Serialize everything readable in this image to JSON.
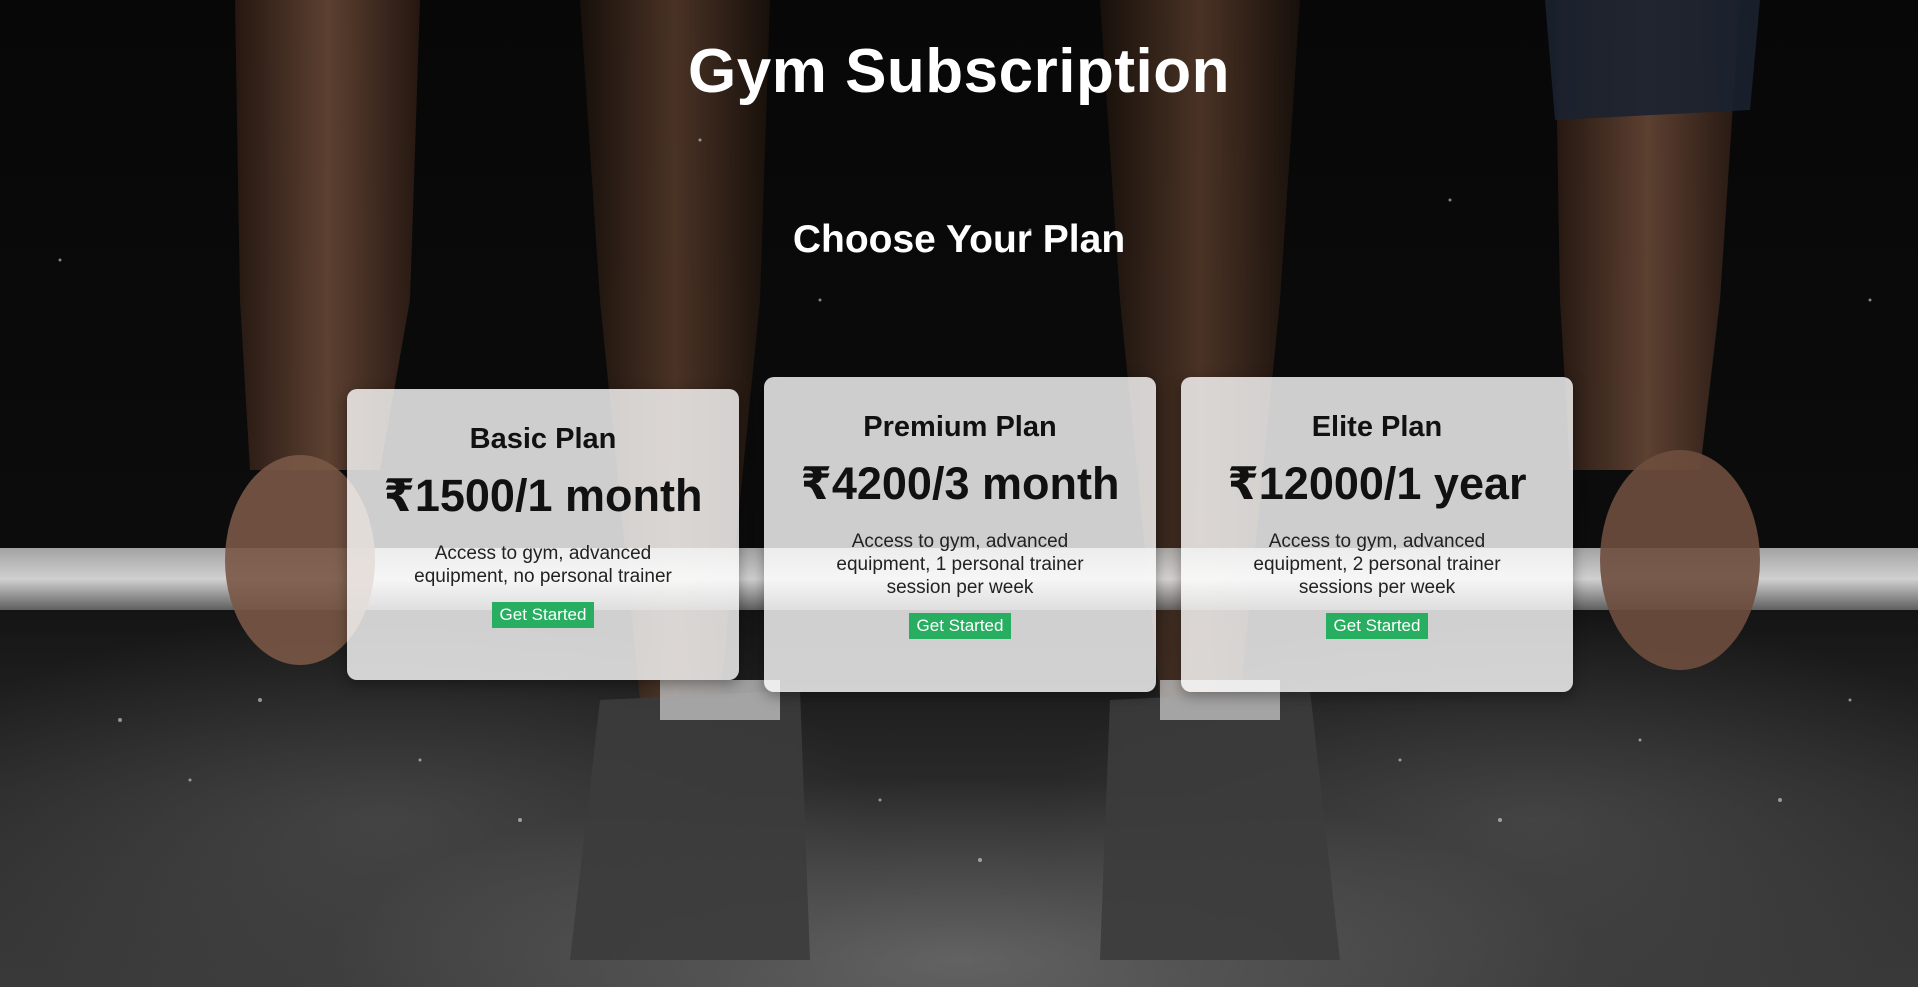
{
  "page": {
    "title": "Gym Subscription",
    "section_title": "Choose Your Plan"
  },
  "plans": [
    {
      "name": "Basic Plan",
      "price": "₹1500/1 month",
      "description": "Access to gym, advanced equipment, no personal trainer",
      "button_label": "Get Started"
    },
    {
      "name": "Premium Plan",
      "price": "₹4200/3 month",
      "description": "Access to gym, advanced equipment, 1 personal trainer session per week",
      "button_label": "Get Started"
    },
    {
      "name": "Elite Plan",
      "price": "₹12000/1 year",
      "description": "Access to gym, advanced equipment, 2 personal trainer sessions per week",
      "button_label": "Get Started"
    }
  ],
  "colors": {
    "button_bg": "#27ae60",
    "title_text": "#ffffff",
    "card_bg": "rgba(255,255,255,0.80)"
  }
}
